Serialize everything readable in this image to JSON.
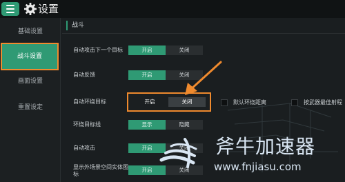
{
  "app": {
    "title": "设置"
  },
  "sidebar": {
    "items": [
      {
        "label": "基础设置",
        "active": false
      },
      {
        "label": "战斗设置",
        "active": true
      },
      {
        "label": "画面设置",
        "active": false
      },
      {
        "label": "重置设定",
        "active": false
      }
    ]
  },
  "section": {
    "title": "战斗"
  },
  "rows": [
    {
      "label": "自动攻击下一个目标",
      "on": "开启",
      "off": "关闭"
    },
    {
      "label": "自动反馈",
      "on": "开启",
      "off": "关闭"
    },
    {
      "label": "自动环绕目标",
      "on": "开启",
      "off": "关闭"
    },
    {
      "label": "环绕目标线",
      "on": "显示",
      "off": "隐藏"
    },
    {
      "label": "自动攻击",
      "on": "开启",
      "off": "关闭"
    },
    {
      "label": "显示外场景空间实体图标",
      "on": "开启",
      "off": "关闭"
    }
  ],
  "checkboxes": [
    {
      "label": "默认环绕距离"
    },
    {
      "label": "按武器最佳射程"
    }
  ],
  "watermark": {
    "title": "斧牛加速器",
    "url": "www.fnjiasu.com"
  },
  "colors": {
    "accent": "#2f9a74",
    "highlight": "#ef8a2e"
  }
}
